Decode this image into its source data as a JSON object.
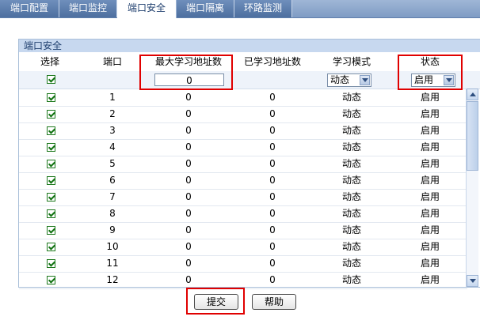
{
  "tabs": [
    {
      "label": "端口配置",
      "active": false
    },
    {
      "label": "端口监控",
      "active": false
    },
    {
      "label": "端口安全",
      "active": true
    },
    {
      "label": "端口隔离",
      "active": false
    },
    {
      "label": "环路监测",
      "active": false
    }
  ],
  "panel": {
    "title": "端口安全",
    "headers": [
      "选择",
      "端口",
      "最大学习地址数",
      "已学习地址数",
      "学习模式",
      "状态"
    ],
    "config_row": {
      "select_checked": true,
      "max_learn_value": "0",
      "learn_mode_value": "动态",
      "status_value": "启用"
    },
    "rows": [
      {
        "checked": true,
        "port": "1",
        "max": "0",
        "learned": "0",
        "mode": "动态",
        "status": "启用"
      },
      {
        "checked": true,
        "port": "2",
        "max": "0",
        "learned": "0",
        "mode": "动态",
        "status": "启用"
      },
      {
        "checked": true,
        "port": "3",
        "max": "0",
        "learned": "0",
        "mode": "动态",
        "status": "启用"
      },
      {
        "checked": true,
        "port": "4",
        "max": "0",
        "learned": "0",
        "mode": "动态",
        "status": "启用"
      },
      {
        "checked": true,
        "port": "5",
        "max": "0",
        "learned": "0",
        "mode": "动态",
        "status": "启用"
      },
      {
        "checked": true,
        "port": "6",
        "max": "0",
        "learned": "0",
        "mode": "动态",
        "status": "启用"
      },
      {
        "checked": true,
        "port": "7",
        "max": "0",
        "learned": "0",
        "mode": "动态",
        "status": "启用"
      },
      {
        "checked": true,
        "port": "8",
        "max": "0",
        "learned": "0",
        "mode": "动态",
        "status": "启用"
      },
      {
        "checked": true,
        "port": "9",
        "max": "0",
        "learned": "0",
        "mode": "动态",
        "status": "启用"
      },
      {
        "checked": true,
        "port": "10",
        "max": "0",
        "learned": "0",
        "mode": "动态",
        "status": "启用"
      },
      {
        "checked": true,
        "port": "11",
        "max": "0",
        "learned": "0",
        "mode": "动态",
        "status": "启用"
      },
      {
        "checked": true,
        "port": "12",
        "max": "0",
        "learned": "0",
        "mode": "动态",
        "status": "启用"
      }
    ]
  },
  "buttons": {
    "submit": "提交",
    "help": "帮助"
  },
  "colors": {
    "highlight": "#e00000",
    "tab_active_text": "#1f3f6e",
    "panel_header": "#c7d8ef"
  }
}
